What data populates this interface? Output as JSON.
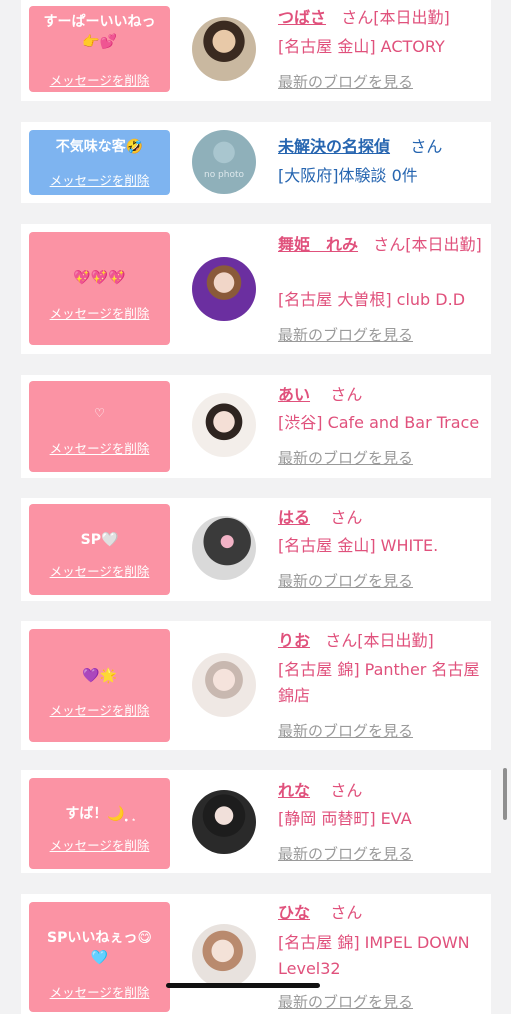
{
  "entries": [
    {
      "message": "すーぱーいいねっ\n👉💕",
      "delete_label": "メッセージを削除",
      "name": "つばさ",
      "honorific": "さん",
      "status": "[本日出勤]",
      "shop": "[名古屋 金山] ACTORY",
      "blog_link": "最新のブログを見る",
      "avatar_icon": "photo-avatar"
    },
    {
      "message": "不気味な客🤣",
      "delete_label": "メッセージを削除",
      "name": "未解決の名探偵",
      "honorific": "さん",
      "status": "",
      "shop": "[大阪府]体験談 0件",
      "blog_link": "",
      "avatar_icon": "no-photo-avatar",
      "avatar_text": "no photo"
    },
    {
      "message": "💖💖💖",
      "delete_label": "メッセージを削除",
      "name": "舞姫　れみ",
      "honorific": "さん",
      "status": "[本日出勤]",
      "shop": "[名古屋 大曽根] club D.D",
      "blog_link": "最新のブログを見る",
      "avatar_icon": "photo-avatar"
    },
    {
      "message": "♡",
      "delete_label": "メッセージを削除",
      "name": "あい",
      "honorific": "さん",
      "status": "",
      "shop": "[渋谷] Cafe and Bar Trace",
      "blog_link": "最新のブログを見る",
      "avatar_icon": "photo-avatar"
    },
    {
      "message": "SP🤍",
      "delete_label": "メッセージを削除",
      "name": "はる",
      "honorific": "さん",
      "status": "",
      "shop": "[名古屋 金山] WHITE.",
      "blog_link": "最新のブログを見る",
      "avatar_icon": "photo-avatar"
    },
    {
      "message": "💜🌟",
      "delete_label": "メッセージを削除",
      "name": "りお",
      "honorific": "さん",
      "status": "[本日出勤]",
      "shop": "[名古屋 錦] Panther 名古屋錦店",
      "blog_link": "最新のブログを見る",
      "avatar_icon": "photo-avatar"
    },
    {
      "message": "すば！🌙 ̣̩ ͙",
      "delete_label": "メッセージを削除",
      "name": "れな",
      "honorific": "さん",
      "status": "",
      "shop": "[静岡 両替町] EVA",
      "blog_link": "最新のブログを見る",
      "avatar_icon": "photo-avatar"
    },
    {
      "message": "SPいいねぇっ😋\n🩵",
      "delete_label": "メッセージを削除",
      "name": "ひな",
      "honorific": "さん",
      "status": "",
      "shop": "[名古屋 錦] IMPEL DOWN Level32",
      "blog_link": "最新のブログを見る",
      "avatar_icon": "photo-avatar"
    }
  ],
  "colors": {
    "accent_pink": "#e0517c",
    "msg_pink": "#fb93a4",
    "msg_blue": "#7eb4f0",
    "link_blue": "#2665b0"
  }
}
